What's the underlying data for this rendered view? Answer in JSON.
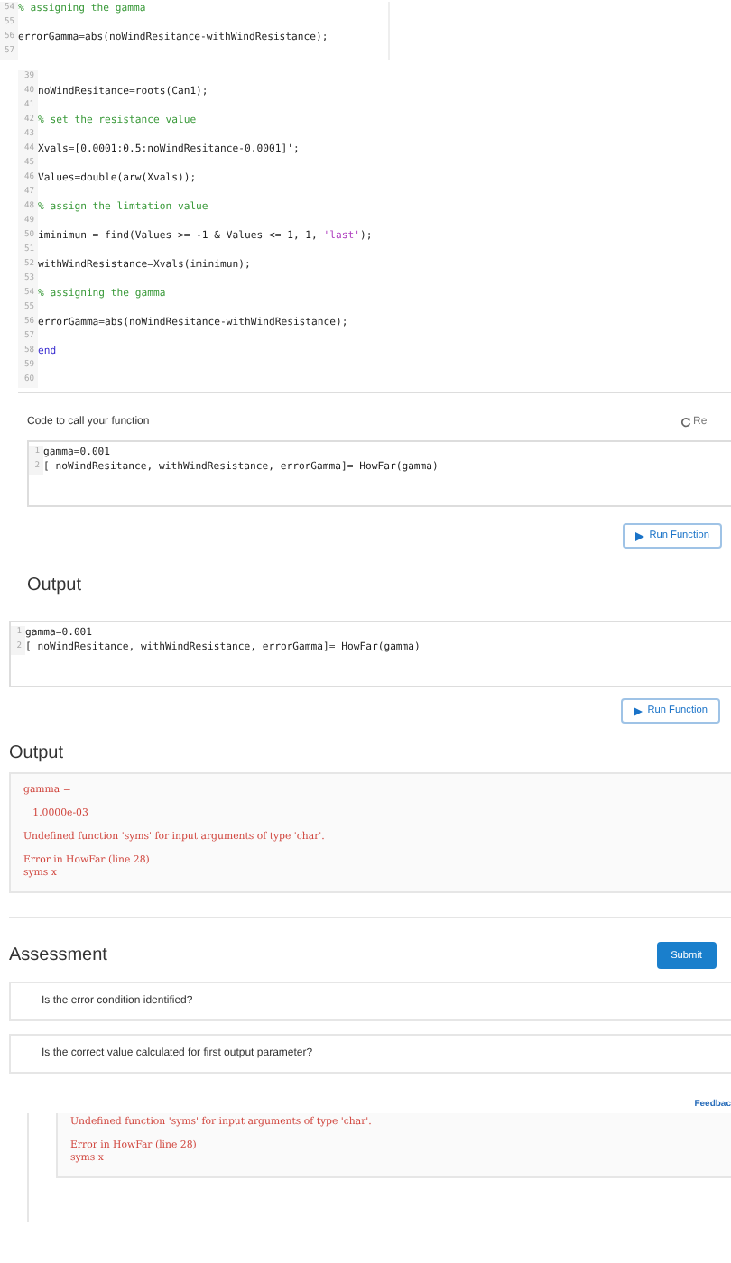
{
  "snippet": {
    "lines": [
      {
        "n": "54",
        "parts": [
          {
            "kind": "comment",
            "text": "% assigning the gamma"
          }
        ]
      },
      {
        "n": "55"
      },
      {
        "n": "56",
        "parts": [
          {
            "kind": "code",
            "text": "errorGamma=abs(noWindResitance-withWindResistance);"
          }
        ]
      },
      {
        "n": "57"
      }
    ]
  },
  "editor": {
    "lines": [
      {
        "n": "39"
      },
      {
        "n": "40",
        "parts": [
          {
            "kind": "code",
            "text": "noWindResitance=roots(Can1);"
          }
        ]
      },
      {
        "n": "41"
      },
      {
        "n": "42",
        "parts": [
          {
            "kind": "comment",
            "text": "% set the resistance value"
          }
        ]
      },
      {
        "n": "43"
      },
      {
        "n": "44",
        "parts": [
          {
            "kind": "code",
            "text": "Xvals=[0.0001:0.5:noWindResitance-0.0001]';"
          }
        ]
      },
      {
        "n": "45"
      },
      {
        "n": "46",
        "parts": [
          {
            "kind": "code",
            "text": "Values=double(arw(Xvals));"
          }
        ]
      },
      {
        "n": "47"
      },
      {
        "n": "48",
        "parts": [
          {
            "kind": "comment",
            "text": "% assign the limtation value"
          }
        ]
      },
      {
        "n": "49"
      },
      {
        "n": "50",
        "parts": [
          {
            "kind": "code",
            "text": "iminimun = find(Values >= -1 & Values <= 1, 1, "
          },
          {
            "kind": "string",
            "text": "'last'"
          },
          {
            "kind": "code",
            "text": ");"
          }
        ]
      },
      {
        "n": "51"
      },
      {
        "n": "52",
        "parts": [
          {
            "kind": "code",
            "text": "withWindResistance=Xvals(iminimun);"
          }
        ]
      },
      {
        "n": "53"
      },
      {
        "n": "54",
        "parts": [
          {
            "kind": "comment",
            "text": "% assigning the gamma"
          }
        ]
      },
      {
        "n": "55"
      },
      {
        "n": "56",
        "parts": [
          {
            "kind": "code",
            "text": "errorGamma=abs(noWindResitance-withWindResistance);"
          }
        ]
      },
      {
        "n": "57"
      },
      {
        "n": "58",
        "parts": [
          {
            "kind": "keyword",
            "text": "end"
          }
        ]
      },
      {
        "n": "59"
      },
      {
        "n": "60"
      }
    ]
  },
  "call_section": {
    "label": "Code to call your function",
    "reset": "Re",
    "lines": [
      {
        "n": "1",
        "parts": [
          {
            "kind": "code",
            "text": "gamma=0.001"
          }
        ]
      },
      {
        "n": "2",
        "parts": [
          {
            "kind": "code",
            "text": "[ noWindResitance, withWindResistance, errorGamma]= HowFar(gamma)"
          }
        ]
      }
    ],
    "run_button": "Run Function"
  },
  "output_1": {
    "heading": "Output",
    "lines": [
      {
        "n": "1",
        "parts": [
          {
            "kind": "code",
            "text": "gamma=0.001"
          }
        ]
      },
      {
        "n": "2",
        "parts": [
          {
            "kind": "code",
            "text": "[ noWindResitance, withWindResistance, errorGamma]= HowFar(gamma)"
          }
        ]
      }
    ],
    "run_button": "Run Function"
  },
  "output_2": {
    "heading": "Output",
    "paragraphs": [
      [
        "gamma ="
      ],
      [
        "   1.0000e-03"
      ],
      [
        "Undefined function 'syms' for input arguments of type 'char'."
      ],
      [
        "Error in HowFar (line 28)",
        "syms x"
      ]
    ]
  },
  "assessment": {
    "heading": "Assessment",
    "submit": "Submit",
    "questions": [
      "Is the error condition identified?",
      "Is the correct value calculated for first output parameter?"
    ]
  },
  "feedback": {
    "link": "Feedbac",
    "paragraphs": [
      [
        "Undefined function 'syms' for input arguments of type 'char'."
      ],
      [
        "Error in HowFar (line 28)",
        "syms x"
      ]
    ]
  }
}
